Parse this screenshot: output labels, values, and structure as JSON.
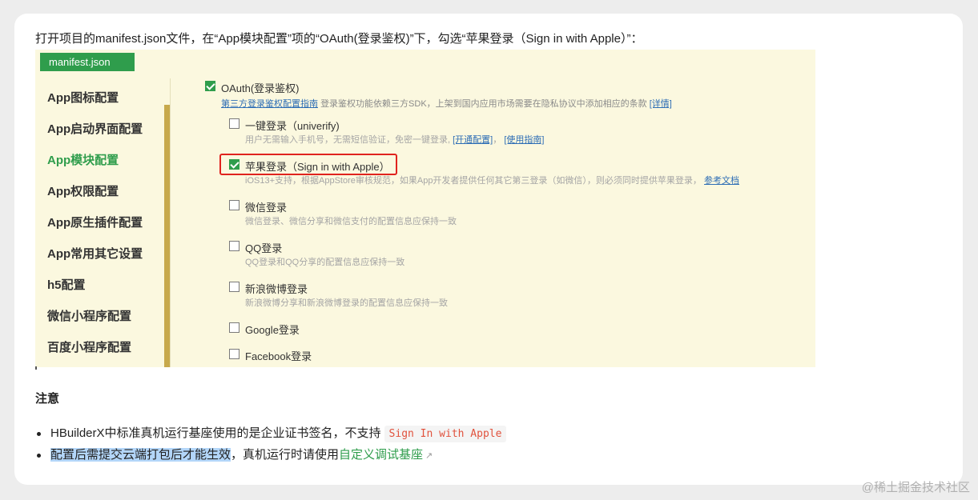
{
  "intro_text": "打开项目的manifest.json文件，在“App模块配置”项的“OAuth(登录鉴权)”下，勾选“苹果登录（Sign in with Apple）”：",
  "file_tab": "manifest.json",
  "sidebar": {
    "items": [
      {
        "label": "App图标配置"
      },
      {
        "label": "App启动界面配置"
      },
      {
        "label": "App模块配置"
      },
      {
        "label": "App权限配置"
      },
      {
        "label": "App原生插件配置"
      },
      {
        "label": "App常用其它设置"
      },
      {
        "label": "h5配置"
      },
      {
        "label": "微信小程序配置"
      },
      {
        "label": "百度小程序配置"
      }
    ]
  },
  "oauth": {
    "label": "OAuth(登录鉴权)",
    "guide_link": "第三方登录鉴权配置指南",
    "guide_desc": "登录鉴权功能依赖三方SDK，上架到国内应用市场需要在隐私协议中添加相应的条款",
    "detail_link": "[详情]"
  },
  "options": [
    {
      "label": "一键登录（univerify)",
      "desc": "用户无需输入手机号，无需短信验证，免密一键登录,",
      "link1": "[开通配置]",
      "sep": "，",
      "link2": "[使用指南]",
      "checked": false
    },
    {
      "label": "苹果登录（Sign in with Apple）",
      "desc": "iOS13+支持，根据AppStore审核规范，如果App开发者提供任何其它第三登录（如微信），则必须同时提供苹果登录，",
      "link1": "参考文档",
      "checked": true
    },
    {
      "label": "微信登录",
      "desc": "微信登录、微信分享和微信支付的配置信息应保持一致",
      "checked": false
    },
    {
      "label": "QQ登录",
      "desc": "QQ登录和QQ分享的配置信息应保持一致",
      "checked": false
    },
    {
      "label": "新浪微博登录",
      "desc": "新浪微博分享和新浪微博登录的配置信息应保持一致",
      "checked": false
    },
    {
      "label": "Google登录",
      "checked": false
    },
    {
      "label": "Facebook登录",
      "checked": false
    }
  ],
  "notice": {
    "title": "注意",
    "bullet1_text": "HBuilderX中标准真机运行基座使用的是企业证书签名，不支持",
    "bullet1_code": "Sign In with Apple",
    "bullet2_highlight": "配置后需提交云端打包后才能生效",
    "bullet2_text": "，真机运行时请使用",
    "bullet2_link": "自定义调试基座"
  },
  "watermark": "@稀土掘金技术社区",
  "colors": {
    "accent_green": "#2f9d4c",
    "highlight_red": "#e0231e",
    "panel_bg": "#fbf8df",
    "link_blue": "#2d6db5"
  }
}
